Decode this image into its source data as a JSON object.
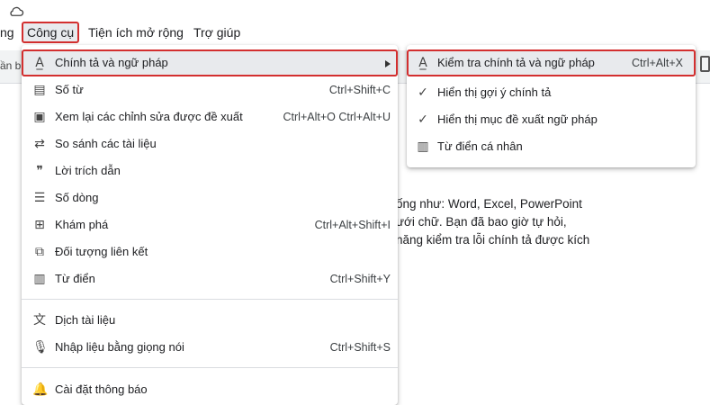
{
  "menubar": {
    "partial_left": "ng",
    "items": [
      "Công cụ",
      "Tiện ích mở rộng",
      "Trợ giúp"
    ]
  },
  "toolbar": {
    "partial_text": "ần b"
  },
  "document": {
    "lines": [
      "ống như: Word, Excel, PowerPoint",
      "ưới chữ. Bạn đã bao giờ tự hỏi,",
      "năng kiểm tra lỗi chính tả được kích"
    ]
  },
  "tools_menu": {
    "items": [
      {
        "icon": "spellcheck-icon",
        "glyph": "A̲",
        "label": "Chính tả và ngữ pháp",
        "shortcut": "",
        "submenu": true
      },
      {
        "icon": "word-count-icon",
        "glyph": "▤",
        "label": "Số từ",
        "shortcut": "Ctrl+Shift+C"
      },
      {
        "icon": "review-edits-icon",
        "glyph": "▣",
        "label": "Xem lại các chỉnh sửa được đề xuất",
        "shortcut": "Ctrl+Alt+O Ctrl+Alt+U"
      },
      {
        "icon": "compare-icon",
        "glyph": "⇄",
        "label": "So sánh các tài liệu",
        "shortcut": ""
      },
      {
        "icon": "quote-icon",
        "glyph": "❞",
        "label": "Lời trích dẫn",
        "shortcut": ""
      },
      {
        "icon": "line-numbers-icon",
        "glyph": "☰",
        "label": "Số dòng",
        "shortcut": ""
      },
      {
        "icon": "explore-icon",
        "glyph": "⊞",
        "label": "Khám phá",
        "shortcut": "Ctrl+Alt+Shift+I"
      },
      {
        "icon": "linked-objects-icon",
        "glyph": "⧉",
        "label": "Đối tượng liên kết",
        "shortcut": ""
      },
      {
        "icon": "dictionary-icon",
        "glyph": "▥",
        "label": "Từ điển",
        "shortcut": "Ctrl+Shift+Y"
      },
      {
        "icon": "translate-icon",
        "glyph": "文",
        "label": "Dịch tài liệu",
        "shortcut": ""
      },
      {
        "icon": "microphone-icon",
        "glyph": "🎙",
        "label": "Nhập liệu bằng giọng nói",
        "shortcut": "Ctrl+Shift+S"
      },
      {
        "icon": "bell-icon",
        "glyph": "🔔",
        "label": "Cài đặt thông báo",
        "shortcut": ""
      }
    ]
  },
  "spelling_submenu": {
    "items": [
      {
        "icon": "spellcheck-icon",
        "glyph": "A̲",
        "label": "Kiểm tra chính tả và ngữ pháp",
        "shortcut": "Ctrl+Alt+X"
      },
      {
        "icon": "check-icon",
        "glyph": "✓",
        "label": "Hiển thị gợi ý chính tả",
        "shortcut": ""
      },
      {
        "icon": "check-icon",
        "glyph": "✓",
        "label": "Hiển thị mục đề xuất ngữ pháp",
        "shortcut": ""
      },
      {
        "icon": "dictionary-icon",
        "glyph": "▥",
        "label": "Từ điển cá nhân",
        "shortcut": ""
      }
    ]
  },
  "colors": {
    "highlight_border": "#d32f2f",
    "hover_bg": "#e8eaed"
  }
}
